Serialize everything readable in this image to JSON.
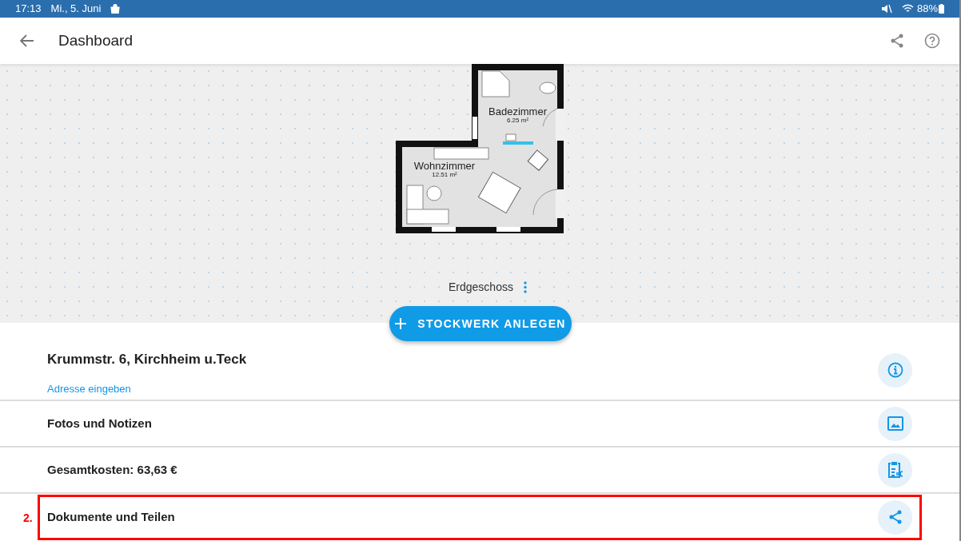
{
  "status_bar": {
    "time": "17:13",
    "date": "Mi., 5. Juni",
    "battery": "88%"
  },
  "header": {
    "title": "Dashboard"
  },
  "floor_plan": {
    "rooms": [
      {
        "name": "Badezimmer",
        "area": "6.25 m²"
      },
      {
        "name": "Wohnzimmer",
        "area": "12.51 m²"
      }
    ],
    "floor_label": "Erdgeschoss"
  },
  "add_floor_button": {
    "label": "STOCKWERK ANLEGEN"
  },
  "sections": [
    {
      "kind": "address",
      "title": "Krummstr. 6, Kirchheim u.Teck",
      "link": "Adresse eingeben"
    },
    {
      "kind": "photos",
      "title": "Fotos und Notizen"
    },
    {
      "kind": "costs",
      "title": "Gesamtkosten: 63,63 €"
    },
    {
      "kind": "documents",
      "title": "Dokumente und Teilen"
    }
  ],
  "annotation": {
    "label": "2."
  }
}
